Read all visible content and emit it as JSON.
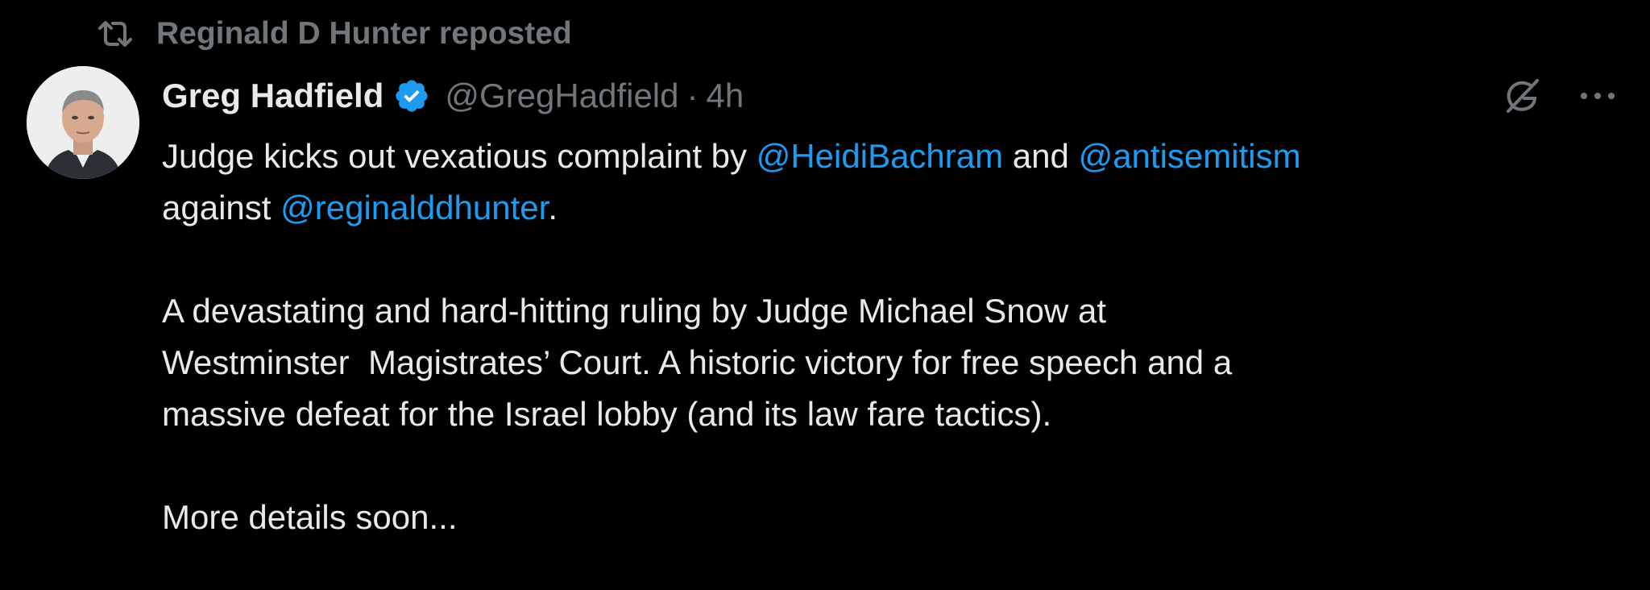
{
  "repost": {
    "text": "Reginald D Hunter reposted",
    "icon": "repost-icon"
  },
  "author": {
    "display_name": "Greg Hadfield",
    "verified_icon": "verified-badge-icon",
    "handle": "@GregHadfield",
    "separator": "·",
    "time": "4h"
  },
  "actions": {
    "grok_icon": "grok-icon",
    "more_icon": "more-icon"
  },
  "tweet": {
    "p1_line1_a": "Judge kicks out vexatious complaint by ",
    "p1_mention1": "@HeidiBachram",
    "p1_line1_b": " and ",
    "p1_mention2": "@antisemitism",
    "p1_line2_a": "against ",
    "p1_mention3": "@reginalddhunter",
    "p1_line2_b": ".",
    "p2_line1": "A devastating and hard-hitting ruling by Judge Michael Snow at",
    "p2_line2": "Westminster  Magistrates’ Court. A historic victory for free speech and a",
    "p2_line3": "massive defeat for the Israel lobby (and its law fare tactics).",
    "p3_line1": "More details soon..."
  },
  "colors": {
    "background": "#000000",
    "primary_text": "#e7e9ea",
    "secondary_text": "#71767b",
    "link": "#1d9bf0",
    "verified": "#1d9bf0"
  }
}
